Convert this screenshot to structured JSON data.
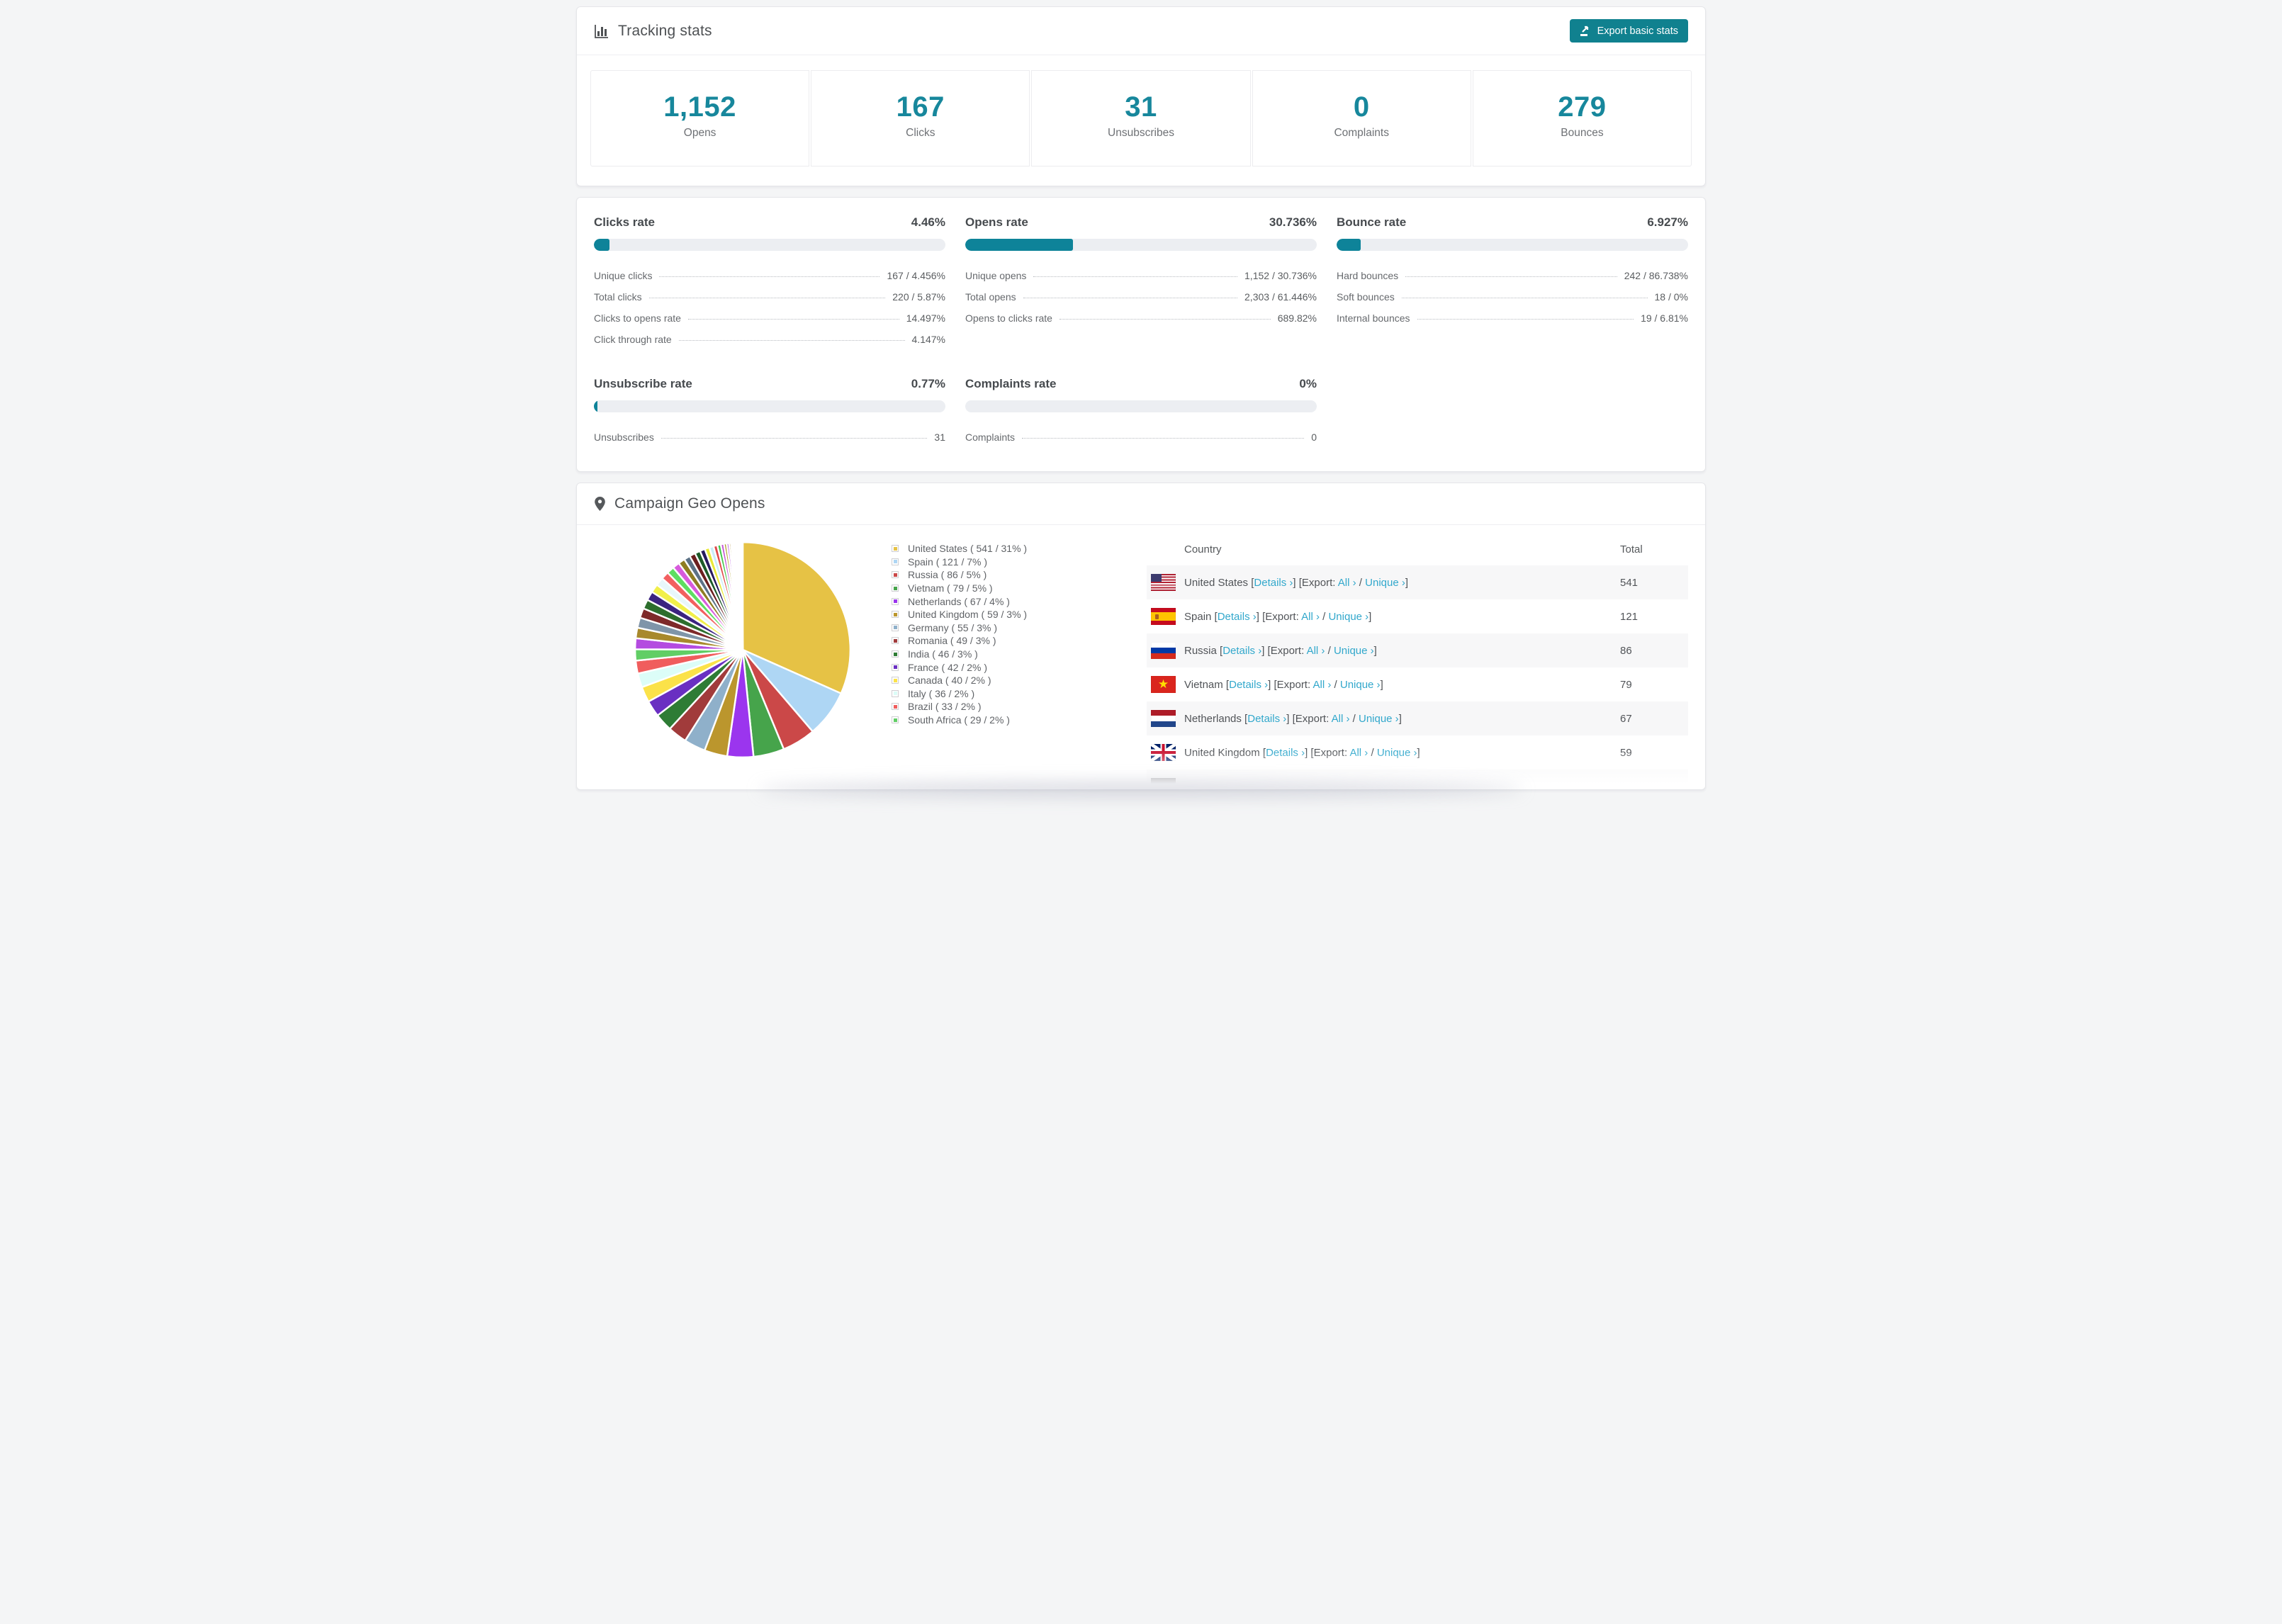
{
  "colors": {
    "accent_teal": "#17879c",
    "button_teal": "#10818f",
    "link_blue": "#32a8cc",
    "progress_track": "#eceef2",
    "row_stripe": "#f7f7f8"
  },
  "header": {
    "title": "Tracking stats",
    "export_button": "Export basic stats"
  },
  "summary": [
    {
      "value": "1,152",
      "label": "Opens"
    },
    {
      "value": "167",
      "label": "Clicks"
    },
    {
      "value": "31",
      "label": "Unsubscribes"
    },
    {
      "value": "0",
      "label": "Complaints"
    },
    {
      "value": "279",
      "label": "Bounces"
    }
  ],
  "rate_cards": [
    {
      "title": "Clicks rate",
      "value": "4.46%",
      "percent": 4.46,
      "rows": [
        {
          "label": "Unique clicks",
          "value": "167 / 4.456%"
        },
        {
          "label": "Total clicks",
          "value": "220 / 5.87%"
        },
        {
          "label": "Clicks to opens rate",
          "value": "14.497%"
        },
        {
          "label": "Click through rate",
          "value": "4.147%"
        }
      ]
    },
    {
      "title": "Opens rate",
      "value": "30.736%",
      "percent": 30.736,
      "rows": [
        {
          "label": "Unique opens",
          "value": "1,152 / 30.736%"
        },
        {
          "label": "Total opens",
          "value": "2,303 / 61.446%"
        },
        {
          "label": "Opens to clicks rate",
          "value": "689.82%"
        }
      ]
    },
    {
      "title": "Bounce rate",
      "value": "6.927%",
      "percent": 6.927,
      "rows": [
        {
          "label": "Hard bounces",
          "value": "242 / 86.738%"
        },
        {
          "label": "Soft bounces",
          "value": "18 / 0%"
        },
        {
          "label": "Internal bounces",
          "value": "19 / 6.81%"
        }
      ]
    },
    {
      "title": "Unsubscribe rate",
      "value": "0.77%",
      "percent": 0.77,
      "rows": [
        {
          "label": "Unsubscribes",
          "value": "31"
        }
      ]
    },
    {
      "title": "Complaints rate",
      "value": "0%",
      "percent": 0,
      "rows": [
        {
          "label": "Complaints",
          "value": "0"
        }
      ]
    }
  ],
  "geo": {
    "title": "Campaign Geo Opens",
    "legend": [
      {
        "label": "United States ( 541 / 31% )",
        "color": "#e6c245"
      },
      {
        "label": "Spain ( 121 / 7% )",
        "color": "#aed6f4"
      },
      {
        "label": "Russia ( 86 / 5% )",
        "color": "#cb4848"
      },
      {
        "label": "Vietnam ( 79 / 5% )",
        "color": "#46a44b"
      },
      {
        "label": "Netherlands ( 67 / 4% )",
        "color": "#9b35ee"
      },
      {
        "label": "United Kingdom ( 59 / 3% )",
        "color": "#bb962d"
      },
      {
        "label": "Germany ( 55 / 3% )",
        "color": "#8fb0ca"
      },
      {
        "label": "Romania ( 49 / 3% )",
        "color": "#a13b3b"
      },
      {
        "label": "India ( 46 / 3% )",
        "color": "#2e7c35"
      },
      {
        "label": "France ( 42 / 2% )",
        "color": "#6a2fc2"
      },
      {
        "label": "Canada ( 40 / 2% )",
        "color": "#fbe249"
      },
      {
        "label": "Italy ( 36 / 2% )",
        "color": "#dcfdf8"
      },
      {
        "label": "Brazil ( 33 / 2% )",
        "color": "#f05d5d"
      },
      {
        "label": "South Africa ( 29 / 2% )",
        "color": "#61ce65"
      }
    ],
    "table": {
      "columns": [
        "Country",
        "Total"
      ],
      "links": {
        "lb": "[",
        "rb": "]",
        "details": "Details ›",
        "export_label": "Export:",
        "all": "All ›",
        "slash": "/",
        "unique": "Unique ›"
      },
      "rows": [
        {
          "country": "United States",
          "flag": "us",
          "total": "541"
        },
        {
          "country": "Spain",
          "flag": "es",
          "total": "121"
        },
        {
          "country": "Russia",
          "flag": "ru",
          "total": "86"
        },
        {
          "country": "Vietnam",
          "flag": "vn",
          "total": "79"
        },
        {
          "country": "Netherlands",
          "flag": "nl",
          "total": "67"
        },
        {
          "country": "United Kingdom",
          "flag": "gb",
          "total": "59"
        },
        {
          "country": "",
          "flag": "de",
          "total": "",
          "partial": true
        }
      ]
    }
  },
  "chart_data": {
    "type": "pie",
    "title": "Campaign Geo Opens",
    "labels": [
      "United States",
      "Spain",
      "Russia",
      "Vietnam",
      "Netherlands",
      "United Kingdom",
      "Germany",
      "Romania",
      "India",
      "France",
      "Canada",
      "Italy",
      "Brazil",
      "South Africa"
    ],
    "values": [
      541,
      121,
      86,
      79,
      67,
      59,
      55,
      49,
      46,
      42,
      40,
      36,
      33,
      29
    ],
    "percent_labels": [
      "31%",
      "7%",
      "5%",
      "5%",
      "4%",
      "3%",
      "3%",
      "3%",
      "3%",
      "2%",
      "2%",
      "2%",
      "2%",
      "2%"
    ],
    "colors": [
      "#e6c245",
      "#aed6f4",
      "#cb4848",
      "#46a44b",
      "#9b35ee",
      "#bb962d",
      "#8fb0ca",
      "#a13b3b",
      "#2e7c35",
      "#6a2fc2",
      "#fbe249",
      "#dcfdf8",
      "#f05d5d",
      "#61ce65"
    ],
    "unlabeled_tail_values": [
      28,
      27,
      26,
      25,
      24,
      23,
      22,
      21,
      20,
      19,
      18,
      17,
      16,
      15,
      14,
      13,
      12,
      11,
      10,
      9,
      8,
      7,
      6,
      5,
      4,
      4,
      3,
      3,
      2,
      2,
      2,
      2,
      1,
      1,
      1,
      1,
      1,
      1,
      1,
      1
    ],
    "tail_color_cycle": [
      "#b44be0",
      "#a8892c",
      "#7f95a9",
      "#7e2a2a",
      "#2d6e2d",
      "#3b2380",
      "#f1ef4a",
      "#e8f7fa",
      "#f26060",
      "#5ede62",
      "#d75bdc",
      "#8f7d22",
      "#5c7286",
      "#6b1f1f",
      "#1d5a28",
      "#271a5e",
      "#e8e838",
      "#c9eef7",
      "#e04848",
      "#44c84c",
      "#c44fd4",
      "#b0a02a"
    ],
    "start_angle_deg": -90,
    "direction": "clockwise",
    "legend_position": "right-of-pie"
  }
}
